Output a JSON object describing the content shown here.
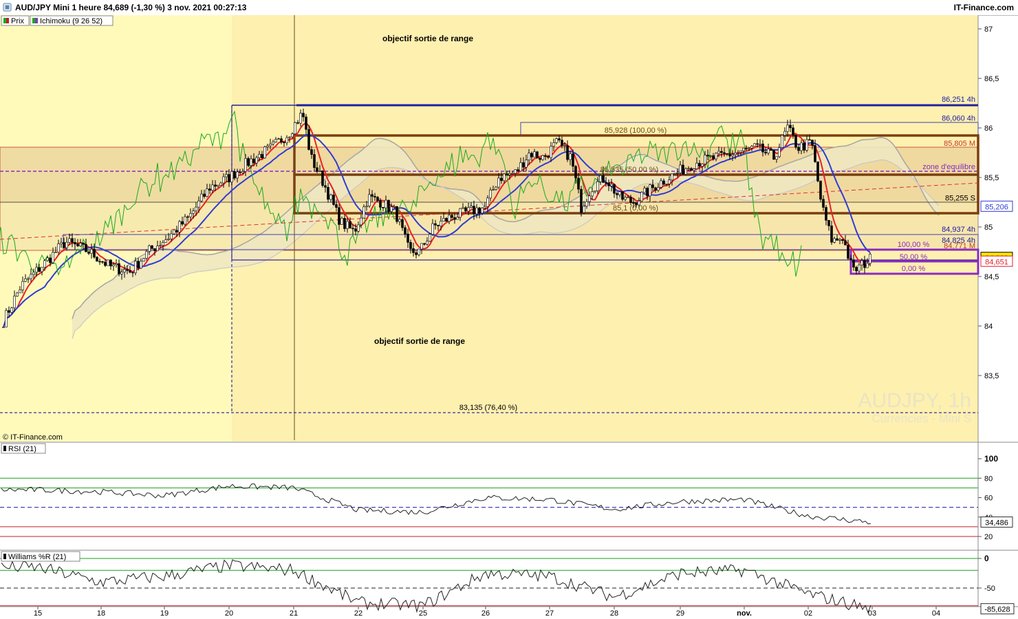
{
  "header": {
    "title": "AUD/JPY Mini 1 heure 84,689 (-1,30 %) 3 nov. 2021 00:27:13",
    "brand": "IT-Finance.com"
  },
  "legend": {
    "prix": "Prix",
    "ichimoku": "Ichimoku (9 26 52)",
    "rsi": "RSI (21)",
    "williams": "Williams %R (21)"
  },
  "watermark": {
    "symbol": "AUDJPY, 1h",
    "market": "Currencies - Mini S"
  },
  "copyright": "© IT-Finance.com",
  "annotations": {
    "objectif_top": "objectif sortie de range",
    "objectif_bottom": "objectif sortie de range",
    "fib_100": "85,928 (100,00 %)",
    "fib_50": "85,535 (50,00 %)",
    "fib_0": "85,1 (0,00 %)",
    "fib_ext": "83,135 (76,40 %)",
    "zone": "zone d'equilibre",
    "small_100": "100,00 %",
    "small_50": "50,00 %",
    "small_0": "0,00 %"
  },
  "levels": [
    {
      "label": "86,251 4h",
      "value": 86.251,
      "color": "#1a1aa8"
    },
    {
      "label": "86,060 4h",
      "value": 86.06,
      "color": "#1a1aa8"
    },
    {
      "label": "85,805 M",
      "value": 85.805,
      "color": "#c0392b"
    },
    {
      "label": "85,255 S",
      "value": 85.255,
      "color": "#000000"
    },
    {
      "label": "84,937 4h",
      "value": 84.937,
      "color": "#1a1aa8"
    },
    {
      "label": "84,825 4h",
      "value": 84.825,
      "color": "#1a1aa8"
    },
    {
      "label": "84,771 M",
      "value": 84.771,
      "color": "#c0392b"
    }
  ],
  "price_badges": [
    {
      "label": "85,206",
      "value": 85.206,
      "color": "#2e3bd6"
    },
    {
      "label": "84,689",
      "value": 84.689,
      "color": "#000000"
    },
    {
      "label": "84,651",
      "value": 84.651,
      "color": "#e0202a"
    }
  ],
  "rsi_badge": "34,486",
  "wr_badge": "-85,628",
  "colors": {
    "tenkan": "#e8202a",
    "kijun": "#2e3bd6",
    "chikou": "#1aaa1a",
    "cloud_edge": "#a8a8a8",
    "cloud_fill": "#efe7c0",
    "range_box": "#7b3f0e",
    "small_box": "#8a2bc2",
    "zone_line": "#8a2bc2"
  },
  "chart_data": [
    {
      "type": "candlestick",
      "name": "AUD/JPY Mini 1 heure",
      "ylim": [
        83.0,
        87.1
      ],
      "y_ticks": [
        "87",
        "86,5",
        "86",
        "85,5",
        "85",
        "84,5",
        "84",
        "83,5"
      ],
      "y_tick_values": [
        87,
        86.5,
        86,
        85.5,
        85,
        84.5,
        84,
        83.5
      ],
      "x_ticks": [
        "15",
        "18",
        "19",
        "20",
        "21",
        "22",
        "25",
        "26",
        "27",
        "28",
        "29",
        "nov.",
        "02",
        "03",
        "04"
      ],
      "series_close_approx": [
        {
          "x": "15",
          "y": 84.15
        },
        {
          "x": "18",
          "y": 84.7
        },
        {
          "x": "19",
          "y": 84.65
        },
        {
          "x": "20",
          "y": 85.45
        },
        {
          "x": "21",
          "y": 86.1
        },
        {
          "x": "22",
          "y": 85.0
        },
        {
          "x": "25",
          "y": 84.8
        },
        {
          "x": "26",
          "y": 85.55
        },
        {
          "x": "27",
          "y": 85.65
        },
        {
          "x": "28",
          "y": 85.45
        },
        {
          "x": "29",
          "y": 85.6
        },
        {
          "x": "nov.",
          "y": 85.75
        },
        {
          "x": "02",
          "y": 85.2
        },
        {
          "x": "03",
          "y": 84.69
        }
      ]
    },
    {
      "type": "line",
      "name": "RSI (21)",
      "ylim": [
        0,
        100
      ],
      "y_ticks": [
        "100",
        "80",
        "60",
        "40",
        "20"
      ],
      "y_tick_values": [
        100,
        80,
        60,
        40,
        20
      ],
      "points": [
        {
          "x": "15",
          "y": 68
        },
        {
          "x": "18",
          "y": 66
        },
        {
          "x": "19",
          "y": 62
        },
        {
          "x": "20",
          "y": 72
        },
        {
          "x": "21",
          "y": 70
        },
        {
          "x": "22",
          "y": 47
        },
        {
          "x": "25",
          "y": 45
        },
        {
          "x": "26",
          "y": 60
        },
        {
          "x": "27",
          "y": 58
        },
        {
          "x": "28",
          "y": 48
        },
        {
          "x": "29",
          "y": 56
        },
        {
          "x": "nov.",
          "y": 58
        },
        {
          "x": "02",
          "y": 41
        },
        {
          "x": "03",
          "y": 34.486
        }
      ]
    },
    {
      "type": "line",
      "name": "Williams %R (21)",
      "ylim": [
        -100,
        0
      ],
      "y_ticks": [
        "0",
        "-50"
      ],
      "y_tick_values": [
        0,
        -50
      ],
      "points": [
        {
          "x": "15",
          "y": -15
        },
        {
          "x": "18",
          "y": -40
        },
        {
          "x": "19",
          "y": -30
        },
        {
          "x": "20",
          "y": -12
        },
        {
          "x": "21",
          "y": -20
        },
        {
          "x": "22",
          "y": -75
        },
        {
          "x": "25",
          "y": -80
        },
        {
          "x": "26",
          "y": -25
        },
        {
          "x": "27",
          "y": -30
        },
        {
          "x": "28",
          "y": -65
        },
        {
          "x": "29",
          "y": -25
        },
        {
          "x": "nov.",
          "y": -20
        },
        {
          "x": "02",
          "y": -60
        },
        {
          "x": "03",
          "y": -85.628
        }
      ]
    }
  ]
}
